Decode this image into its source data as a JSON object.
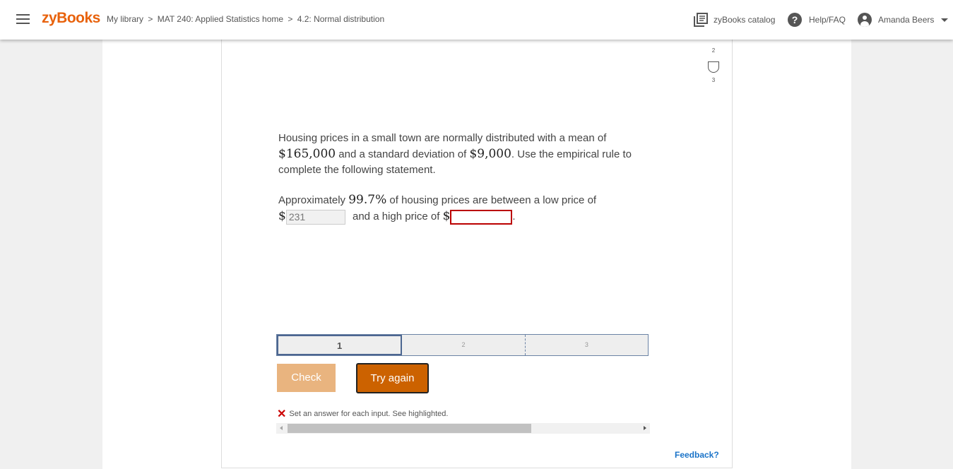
{
  "header": {
    "logo": "zyBooks",
    "breadcrumb": [
      "My library",
      "MAT 240: Applied Statistics home",
      "4.2: Normal distribution"
    ],
    "breadcrumb_sep": ">",
    "catalog_label": "zyBooks catalog",
    "help_label": "Help/FAQ",
    "help_glyph": "?",
    "user_name": "Amanda Beers"
  },
  "levels": [
    {
      "num": "2"
    },
    {
      "num": "3"
    }
  ],
  "problem": {
    "p1_a": "Housing prices in a small town are normally distributed with a mean of",
    "mean": "$165,000",
    "p1_b": "and a standard deviation of",
    "sd": "$9,000",
    "p1_c": ". Use the empirical rule to complete the following statement.",
    "p2_a": "Approximately",
    "pct": "99.7%",
    "p2_b": "of housing prices are between a low price of",
    "dollar": "$",
    "low_value": "231",
    "p2_c": "and a high price of",
    "high_value": "",
    "period": "."
  },
  "progress": {
    "steps": [
      "1",
      "2",
      "3"
    ],
    "active": 1
  },
  "buttons": {
    "check": "Check",
    "try_again": "Try again"
  },
  "error": {
    "icon": "✕",
    "message": "Set an answer for each input. See highlighted."
  },
  "feedback": "Feedback?",
  "colors": {
    "brand": "#e8620c",
    "try_again": "#cc6200",
    "check_disabled": "#e9b47f",
    "error": "#cc0000",
    "link": "#1a73c8"
  }
}
